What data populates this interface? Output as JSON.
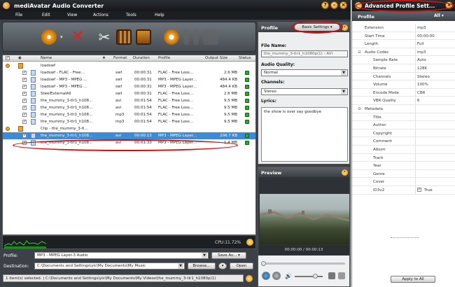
{
  "app": {
    "title": "mediAvatar Audio Converter"
  },
  "window_controls": [
    "?",
    "–",
    "×"
  ],
  "menu": [
    "File",
    "Edit",
    "View",
    "Actions",
    "Tools",
    "Help"
  ],
  "columns": {
    "name": "Name",
    "star": "★",
    "format": "Format",
    "duration": "Duration",
    "profile": "Profile",
    "output_size": "Output Size",
    "status": "Status"
  },
  "rows": [
    {
      "name": "loadswf",
      "group": true
    },
    {
      "name": "loadswf - FLAC - Free…",
      "format": "swf",
      "duration": "00:00:31",
      "profile": "FLAC - Free Loss…",
      "size": "2.6 MB"
    },
    {
      "name": "loadswf - MP3 - MPEG …",
      "format": "swf",
      "duration": "00:00:31",
      "profile": "MP3 - MPEG Layer…",
      "size": "484.4 KB"
    },
    {
      "name": "loadswf - MP3 - MPEG …",
      "format": "swf",
      "duration": "00:00:31",
      "profile": "MP3 - MPEG Layer…",
      "size": "484.4 KB"
    },
    {
      "name": "SteelExternalAll",
      "format": "swf",
      "duration": "00:00:31",
      "profile": "FLAC - Free Loss…",
      "size": "2.6 MB"
    },
    {
      "name": "the_mummy_3-tlr1_h108…",
      "format": "avi",
      "duration": "00:01:54",
      "profile": "FLAC - Free Loss…",
      "size": "9.5 MB"
    },
    {
      "name": "the_mummy_3-tlr1_h108…",
      "format": "avi",
      "duration": "00:01:54",
      "profile": "FLAC - Free Loss…",
      "size": "9.5 MB"
    },
    {
      "name": "the_mummy_3-tlr1_h108…",
      "format": "mp3",
      "duration": "00:01:54",
      "profile": "FLAC - Free Loss…",
      "size": "9.5 MB"
    },
    {
      "name": "the_mummy_3-tlr1_h108…",
      "format": "mp3",
      "duration": "00:01:54",
      "profile": "FLAC - Free Loss…",
      "size": "9.5 MB"
    },
    {
      "name": "Clip - the_mummy_3-tl…",
      "group": true
    },
    {
      "name": "the_mummy_3-tlr1_h108…",
      "format": "avi",
      "duration": "00:00:13",
      "profile": "MP3 - MPEG Layer…",
      "size": "206.7 KB",
      "selected": true
    },
    {
      "name": "the_mummy_3-tlr1_h108…",
      "format": "avi",
      "duration": "00:01:33",
      "profile": "MP3 - MPEG Layer…",
      "size": "1.4 MB"
    }
  ],
  "status": {
    "cpu": "CPU:11.72%"
  },
  "bottom": {
    "profile_label": "Profile:",
    "profile_value": "MP3 - MPEG Layer-3 Audio",
    "save_as": "Save As...",
    "destination_label": "Destination:",
    "destination_value": "C:\\Documents and Settings\\ylc\\My Documents\\My Music",
    "browse": "Browse...",
    "open": "Open",
    "message": "1 item(s) selected. | C:\\Documents and Settings\\ylc\\My Documents\\My Videos\\the_mummy_3-tlr1_h1080p(1)"
  },
  "profile_panel": {
    "title": "Profile",
    "settings_button": "Basic Settings",
    "file_name_label": "File Name:",
    "file_name_value": "the_mummy_3-tlr1_h1080p(1) - AVI",
    "audio_quality_label": "Audio Quality:",
    "audio_quality_value": "Normal",
    "channels_label": "Channels:",
    "channels_value": "Stereo",
    "lyrics_label": "Lyrics:",
    "lyrics_value": "the show is over say goodbye"
  },
  "preview": {
    "title": "Preview",
    "time": "00:00:00 / 00:00:13"
  },
  "advanced": {
    "title": "Advanced Profile Sett...",
    "header_label": "Profile",
    "header_filter": "All",
    "apply_button": "Apply to All",
    "props": [
      {
        "k": "Extension",
        "v": "mp3",
        "indent": 1
      },
      {
        "k": "Start Time",
        "v": "00:00:00",
        "indent": 1
      },
      {
        "k": "Length",
        "v": "Full",
        "indent": 1
      },
      {
        "k": "Audio Codec",
        "v": "mp3",
        "indent": 1,
        "group": true
      },
      {
        "k": "Sample Rate",
        "v": "Auto",
        "indent": 2
      },
      {
        "k": "Bitrate",
        "v": "128K",
        "indent": 2
      },
      {
        "k": "Channels",
        "v": "Stereo",
        "indent": 2
      },
      {
        "k": "Volume",
        "v": "100%",
        "indent": 2
      },
      {
        "k": "Encode Mode",
        "v": "CBR",
        "indent": 2
      },
      {
        "k": "VBR Quality",
        "v": "6",
        "indent": 2
      },
      {
        "k": "Metadata",
        "v": "",
        "indent": 1,
        "group": true
      },
      {
        "k": "Title",
        "v": "",
        "indent": 2
      },
      {
        "k": "Author",
        "v": "",
        "indent": 2
      },
      {
        "k": "Copyright",
        "v": "",
        "indent": 2
      },
      {
        "k": "Comment",
        "v": "",
        "indent": 2
      },
      {
        "k": "Album",
        "v": "",
        "indent": 2
      },
      {
        "k": "Track",
        "v": "",
        "indent": 2
      },
      {
        "k": "Year",
        "v": "",
        "indent": 2
      },
      {
        "k": "Genre",
        "v": "",
        "indent": 2
      },
      {
        "k": "Cover",
        "v": "",
        "indent": 2
      },
      {
        "k": "ID3v2",
        "v": "True",
        "indent": 2,
        "check": true
      }
    ]
  }
}
